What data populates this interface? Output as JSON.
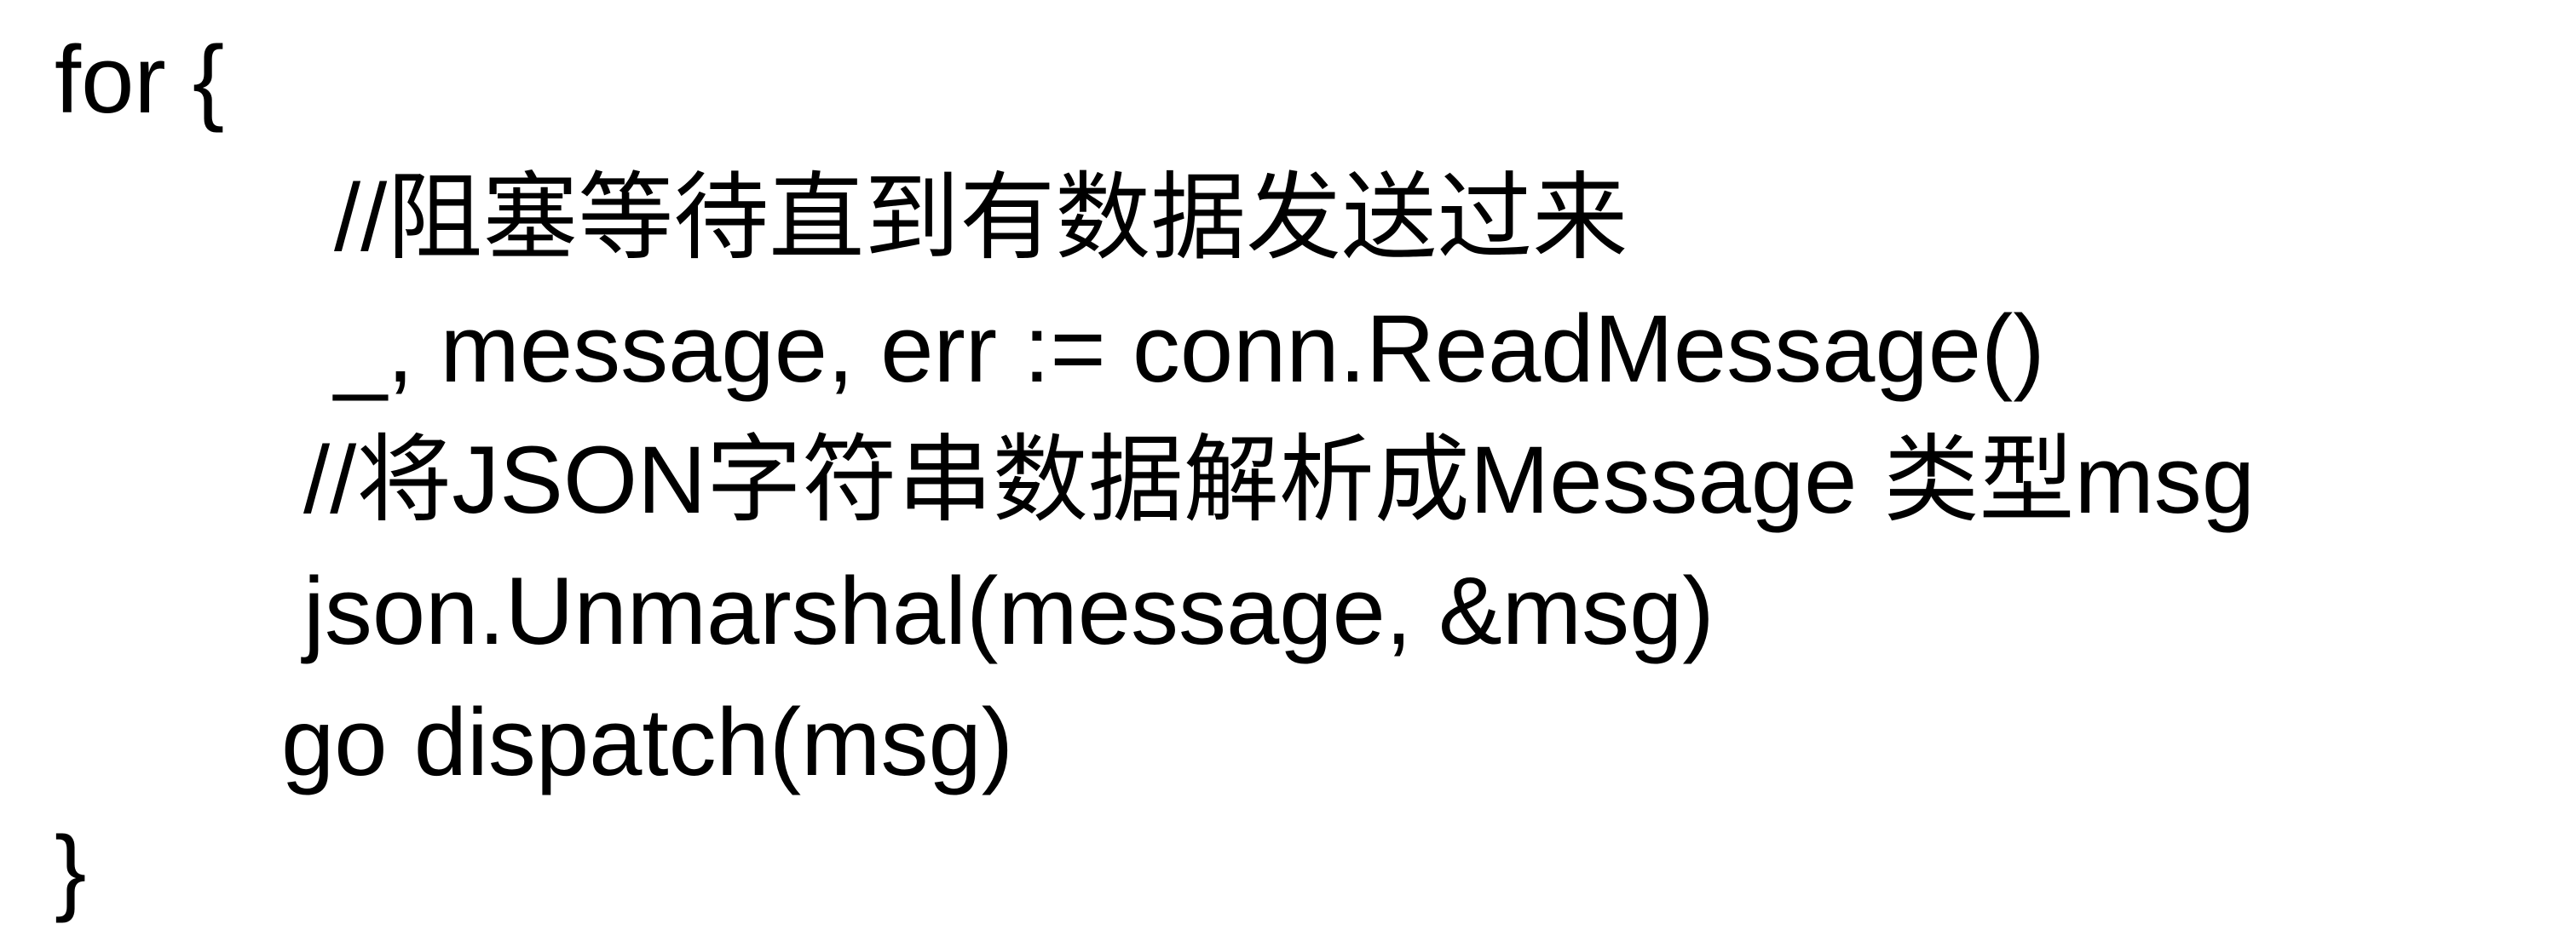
{
  "code": {
    "lines": [
      "for {",
      "//阻塞等待直到有数据发送过来",
      "_, message, err := conn.ReadMessage()",
      "//将JSON字符串数据解析成Message 类型msg",
      "json.Unmarshal(message, &msg)",
      "go dispatch(msg)",
      "}"
    ]
  }
}
